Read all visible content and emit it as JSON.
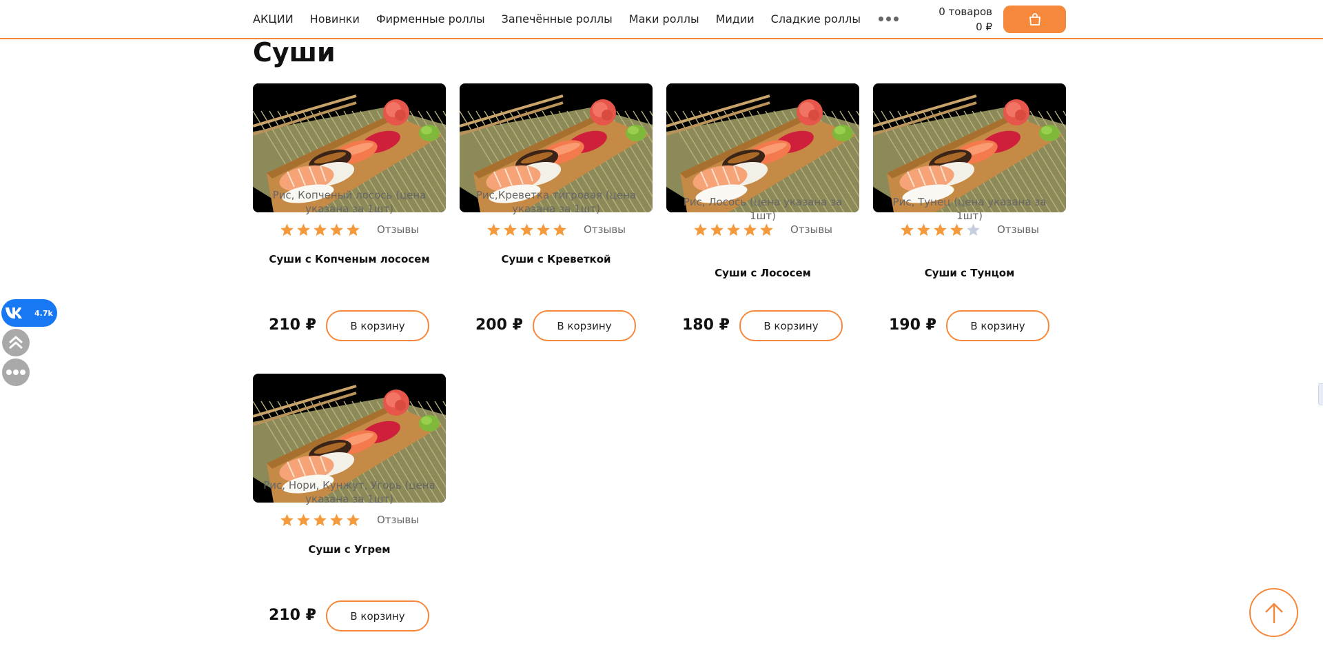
{
  "header": {
    "nav": [
      "АКЦИИ",
      "Новинки",
      "Фирменные роллы",
      "Запечённые роллы",
      "Маки роллы",
      "Мидии",
      "Сладкие роллы"
    ],
    "more_icon": "more-dots-icon",
    "cart": {
      "items_label": "0 товаров",
      "total_label": "0 ₽",
      "button_icon": "shopping-bag-icon"
    }
  },
  "section": {
    "title": "Суши"
  },
  "products": [
    {
      "name": "Суши с Копченым лососем",
      "description": "Рис, Копченый лосось (цена указана за 1шт)",
      "price": "210 ₽",
      "rating": 5,
      "reviews_label": "Отзывы",
      "button_label": "В корзину"
    },
    {
      "name": "Суши с Креветкой",
      "description": "Рис,Креветка тигровая (цена указана за 1шт)",
      "price": "200 ₽",
      "rating": 5,
      "reviews_label": "Отзывы",
      "button_label": "В корзину"
    },
    {
      "name": "Суши с Лососем",
      "description": "Рис, Лосось (цена указана за 1шт)",
      "price": "180 ₽",
      "rating": 5,
      "reviews_label": "Отзывы",
      "button_label": "В корзину"
    },
    {
      "name": "Суши с Тунцом",
      "description": "Рис, Тунец (цена указана за 1шт)",
      "price": "190 ₽",
      "rating": 4,
      "reviews_label": "Отзывы",
      "button_label": "В корзину"
    },
    {
      "name": "Суши с Угрем",
      "description": "Рис, Нори, Кунжут, Угорь (цена указана за 1шт)",
      "price": "210 ₽",
      "rating": 5,
      "reviews_label": "Отзывы",
      "button_label": "В корзину"
    }
  ],
  "sidebar_widgets": {
    "vk_count": "4.7k",
    "vk_icon": "vk-logo-icon",
    "scroll_up_icon": "double-chevron-up-icon",
    "more_icon": "more-dots-icon"
  },
  "scroll_top_icon": "arrow-up-icon",
  "colors": {
    "accent": "#f5883a",
    "star_on": "#f5993d",
    "star_off": "#c5cedc",
    "vk": "#1877f2"
  }
}
